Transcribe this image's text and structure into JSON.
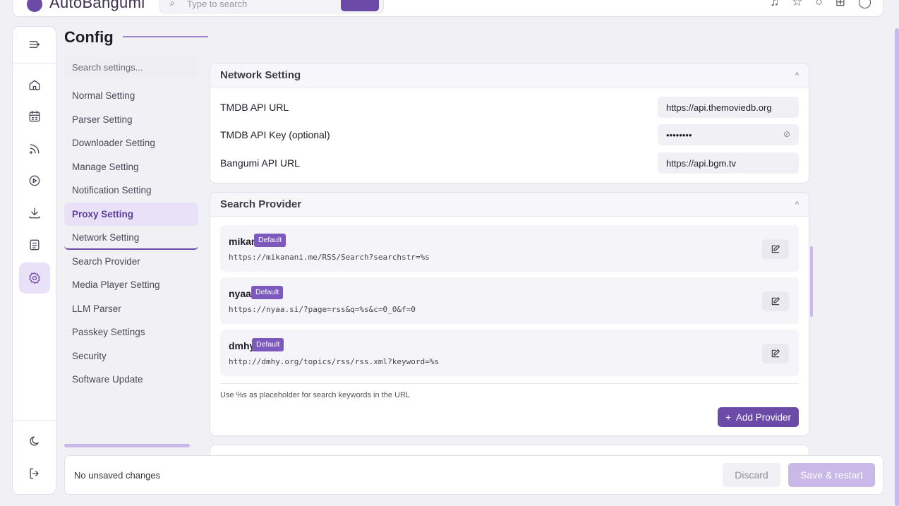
{
  "app": {
    "title": "AutoBangumi"
  },
  "top_search": {
    "placeholder": "Type to search"
  },
  "page": {
    "title": "Config"
  },
  "nav": {
    "search_placeholder": "Search settings...",
    "items": [
      "Normal Setting",
      "Parser Setting",
      "Downloader Setting",
      "Manage Setting",
      "Notification Setting",
      "Proxy Setting",
      "Network Setting",
      "Search Provider",
      "Media Player Setting",
      "LLM Parser",
      "Passkey Settings",
      "Security",
      "Software Update"
    ],
    "active": "Proxy Setting"
  },
  "network": {
    "title": "Network Setting",
    "rows": [
      {
        "label": "TMDB API URL",
        "value": "https://api.themoviedb.org"
      },
      {
        "label": "TMDB API Key (optional)",
        "value": "••••••••"
      },
      {
        "label": "Bangumi API URL",
        "value": "https://api.bgm.tv"
      }
    ]
  },
  "search_provider": {
    "title": "Search Provider",
    "providers": [
      {
        "name": "mikan",
        "badge": "Default",
        "url": "https://mikanani.me/RSS/Search?searchstr=%s"
      },
      {
        "name": "nyaa",
        "badge": "Default",
        "url": "https://nyaa.si/?page=rss&q=%s&c=0_0&f=0"
      },
      {
        "name": "dmhy",
        "badge": "Default",
        "url": "http://dmhy.org/topics/rss/rss.xml?keyword=%s"
      }
    ],
    "hint": "Use %s as placeholder for search keywords in the URL",
    "add_label": "Add Provider"
  },
  "footer": {
    "status": "No unsaved changes",
    "discard": "Discard",
    "save": "Save & restart"
  },
  "colors": {
    "accent": "#6c4ba8",
    "accent_light": "#e9e1f7"
  }
}
